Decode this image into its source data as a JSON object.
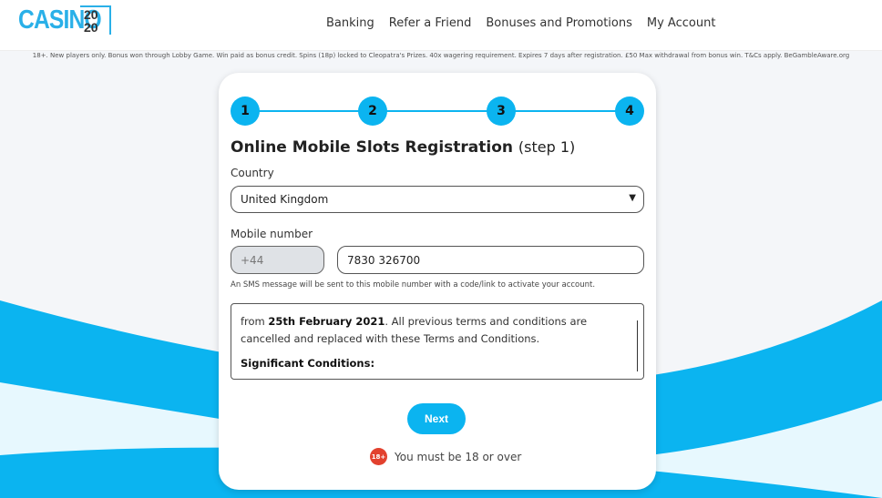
{
  "logo": {
    "text": "CASINO",
    "num_top": "20",
    "num_bottom": "20"
  },
  "nav": [
    "Banking",
    "Refer a Friend",
    "Bonuses and Promotions",
    "My Account"
  ],
  "disclaimer": "18+. New players only. Bonus won through Lobby Game. Win paid as bonus credit. Spins (18p) locked to Cleopatra's Prizes. 40x wagering requirement. Expires 7 days after registration. £50 Max withdrawal from bonus win. T&Cs apply. BeGambleAware.org",
  "steps": [
    "1",
    "2",
    "3",
    "4"
  ],
  "form": {
    "title": "Online Mobile Slots Registration",
    "title_suffix": "(step 1)",
    "country_label": "Country",
    "country_value": "United Kingdom",
    "mobile_label": "Mobile number",
    "prefix": "+44",
    "phone": "7830 326700",
    "hint": "An SMS message will be sent to this mobile number with a code/link to activate your account.",
    "terms_pre": "from ",
    "terms_bold": "25th February 2021",
    "terms_post": ". All previous terms and conditions are cancelled and replaced with these Terms and Conditions.",
    "terms_heading": "Significant Conditions:",
    "next": "Next",
    "age_badge": "18+",
    "age_text": "You must be 18 or over"
  },
  "colors": {
    "accent": "#0bb4f0",
    "badge": "#e2412e"
  }
}
